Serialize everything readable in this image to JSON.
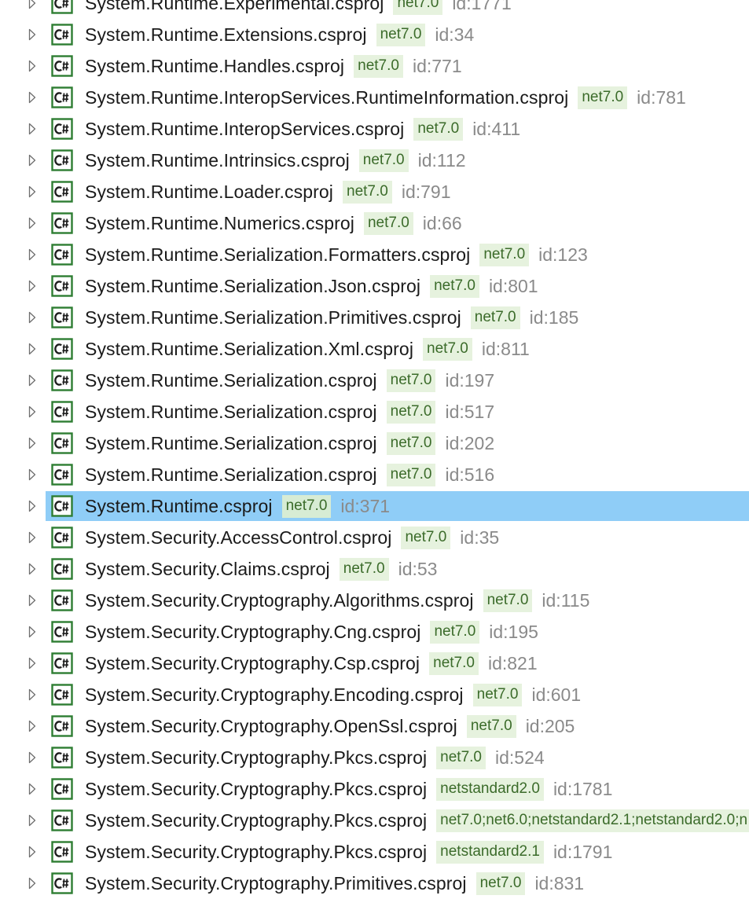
{
  "colors": {
    "selection": "#8fcdf7",
    "tag_background": "#e6f2de",
    "tag_text": "#3b6b2a",
    "id_text": "#8a8a8a",
    "icon_green": "#2e7d32"
  },
  "icons": {
    "expander": "triangle-right-outline",
    "project": "csharp-project-icon"
  },
  "projects": [
    {
      "name": "System.Runtime.Experimental.csproj",
      "tag": "net7.0",
      "id": "id:1771"
    },
    {
      "name": "System.Runtime.Extensions.csproj",
      "tag": "net7.0",
      "id": "id:34"
    },
    {
      "name": "System.Runtime.Handles.csproj",
      "tag": "net7.0",
      "id": "id:771"
    },
    {
      "name": "System.Runtime.InteropServices.RuntimeInformation.csproj",
      "tag": "net7.0",
      "id": "id:781"
    },
    {
      "name": "System.Runtime.InteropServices.csproj",
      "tag": "net7.0",
      "id": "id:411"
    },
    {
      "name": "System.Runtime.Intrinsics.csproj",
      "tag": "net7.0",
      "id": "id:112"
    },
    {
      "name": "System.Runtime.Loader.csproj",
      "tag": "net7.0",
      "id": "id:791"
    },
    {
      "name": "System.Runtime.Numerics.csproj",
      "tag": "net7.0",
      "id": "id:66"
    },
    {
      "name": "System.Runtime.Serialization.Formatters.csproj",
      "tag": "net7.0",
      "id": "id:123"
    },
    {
      "name": "System.Runtime.Serialization.Json.csproj",
      "tag": "net7.0",
      "id": "id:801"
    },
    {
      "name": "System.Runtime.Serialization.Primitives.csproj",
      "tag": "net7.0",
      "id": "id:185"
    },
    {
      "name": "System.Runtime.Serialization.Xml.csproj",
      "tag": "net7.0",
      "id": "id:811"
    },
    {
      "name": "System.Runtime.Serialization.csproj",
      "tag": "net7.0",
      "id": "id:197"
    },
    {
      "name": "System.Runtime.Serialization.csproj",
      "tag": "net7.0",
      "id": "id:517"
    },
    {
      "name": "System.Runtime.Serialization.csproj",
      "tag": "net7.0",
      "id": "id:202"
    },
    {
      "name": "System.Runtime.Serialization.csproj",
      "tag": "net7.0",
      "id": "id:516"
    },
    {
      "name": "System.Runtime.csproj",
      "tag": "net7.0",
      "id": "id:371",
      "selected": true
    },
    {
      "name": "System.Security.AccessControl.csproj",
      "tag": "net7.0",
      "id": "id:35"
    },
    {
      "name": "System.Security.Claims.csproj",
      "tag": "net7.0",
      "id": "id:53"
    },
    {
      "name": "System.Security.Cryptography.Algorithms.csproj",
      "tag": "net7.0",
      "id": "id:115"
    },
    {
      "name": "System.Security.Cryptography.Cng.csproj",
      "tag": "net7.0",
      "id": "id:195"
    },
    {
      "name": "System.Security.Cryptography.Csp.csproj",
      "tag": "net7.0",
      "id": "id:821"
    },
    {
      "name": "System.Security.Cryptography.Encoding.csproj",
      "tag": "net7.0",
      "id": "id:601"
    },
    {
      "name": "System.Security.Cryptography.OpenSsl.csproj",
      "tag": "net7.0",
      "id": "id:205"
    },
    {
      "name": "System.Security.Cryptography.Pkcs.csproj",
      "tag": "net7.0",
      "id": "id:524"
    },
    {
      "name": "System.Security.Cryptography.Pkcs.csproj",
      "tag": "netstandard2.0",
      "id": "id:1781"
    },
    {
      "name": "System.Security.Cryptography.Pkcs.csproj",
      "tag": "net7.0;net6.0;netstandard2.1;netstandard2.0;n",
      "id": ""
    },
    {
      "name": "System.Security.Cryptography.Pkcs.csproj",
      "tag": "netstandard2.1",
      "id": "id:1791"
    },
    {
      "name": "System.Security.Cryptography.Primitives.csproj",
      "tag": "net7.0",
      "id": "id:831"
    }
  ]
}
